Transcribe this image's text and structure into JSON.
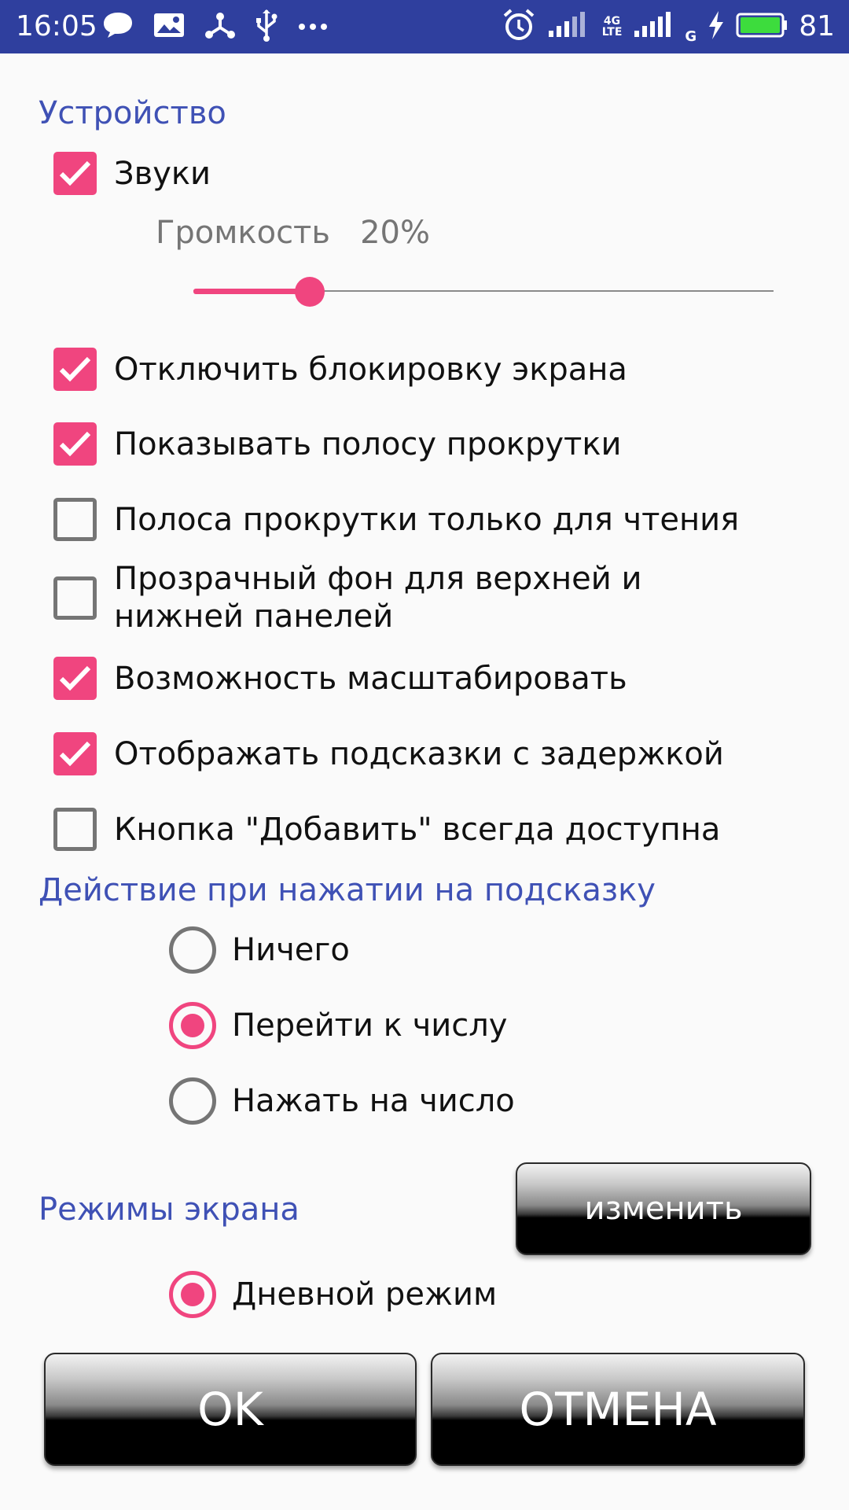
{
  "status_bar": {
    "time": "16:05",
    "battery_level": "81",
    "network_label_top": "4G",
    "network_label_bottom": "LTE",
    "network_label_g": "G",
    "left_icons": [
      "chat-bubble-icon",
      "image-icon",
      "share-icon",
      "usb-icon",
      "more-dots-icon"
    ],
    "right_icons": [
      "alarm-icon",
      "signal-icon",
      "signal-icon",
      "charging-icon",
      "battery-icon"
    ]
  },
  "device": {
    "title": "Устройство",
    "sounds": {
      "label": "Звуки",
      "checked": true
    },
    "volume": {
      "label": "Громкость",
      "value_text": "20%",
      "value": 0.2
    }
  },
  "options": [
    {
      "label": "Отключить блокировку экрана",
      "checked": true
    },
    {
      "label": "Показывать полосу прокрутки",
      "checked": true
    },
    {
      "label": "Полоса прокрутки только для чтения",
      "checked": false
    },
    {
      "label": "Прозрачный фон для верхней и нижней панелей",
      "checked": false
    },
    {
      "label": "Возможность масштабировать",
      "checked": true
    },
    {
      "label": "Отображать подсказки с задержкой",
      "checked": true
    },
    {
      "label": "Кнопка \"Добавить\" всегда доступна",
      "checked": false
    }
  ],
  "hint_action": {
    "title": "Действие при нажатии на подсказку",
    "choices": [
      {
        "label": "Ничего",
        "selected": false
      },
      {
        "label": "Перейти к числу",
        "selected": true
      },
      {
        "label": "Нажать на число",
        "selected": false
      }
    ]
  },
  "screen_modes": {
    "title": "Режимы экрана",
    "change_label": "изменить",
    "choice": {
      "label": "Дневной режим",
      "selected": true
    }
  },
  "dialog_buttons": {
    "ok_label": "OK",
    "cancel_label": "ОТМЕНА"
  },
  "colors": {
    "status_bar": "#2f3f9e",
    "accent": "#f0457f",
    "section_title": "#3f51b5",
    "background": "#fafafa"
  }
}
